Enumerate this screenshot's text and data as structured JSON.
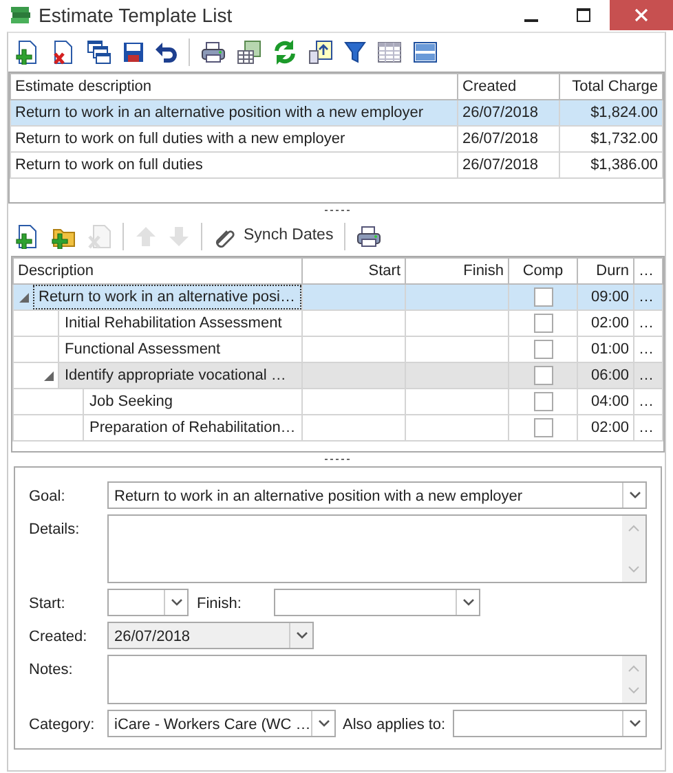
{
  "window": {
    "title": "Estimate Template List"
  },
  "templates": {
    "columns": [
      "Estimate description",
      "Created",
      "Total Charge"
    ],
    "rows": [
      {
        "description": "Return to work in an alternative position with a new employer",
        "created": "26/07/2018",
        "total_charge": "$1,824.00",
        "selected": true
      },
      {
        "description": "Return to work on full duties with a new employer",
        "created": "26/07/2018",
        "total_charge": "$1,732.00",
        "selected": false
      },
      {
        "description": "Return to work on full duties",
        "created": "26/07/2018",
        "total_charge": "$1,386.00",
        "selected": false
      }
    ]
  },
  "task_toolbar": {
    "groups": [
      [
        {
          "kind": "add",
          "disabled": false
        },
        {
          "kind": "add-folder",
          "disabled": false
        },
        {
          "kind": "delete",
          "disabled": true
        }
      ],
      [
        {
          "kind": "up",
          "disabled": true
        },
        {
          "kind": "down",
          "disabled": true
        }
      ],
      [
        {
          "kind": "synch",
          "label": "Synch Dates",
          "disabled": false
        }
      ],
      [
        {
          "kind": "print",
          "disabled": false
        }
      ]
    ]
  },
  "tasks": {
    "columns": [
      "Description",
      "Start",
      "Finish",
      "Comp",
      "Durn",
      "…"
    ],
    "rows": [
      {
        "description": "Return to work in an alternative posi…",
        "comp": false,
        "durn": "09:00",
        "more": "…",
        "selected": true,
        "expanded": true,
        "children": [
          {
            "description": "Initial Rehabilitation Assessment",
            "comp": false,
            "durn": "02:00",
            "more": "…",
            "selected": false
          },
          {
            "description": "Functional Assessment",
            "comp": false,
            "durn": "01:00",
            "more": "…",
            "selected": false
          },
          {
            "description": "Identify appropriate vocational …",
            "comp": false,
            "durn": "06:00",
            "more": "…",
            "selected": false,
            "expanded": true,
            "children": [
              {
                "description": "Job Seeking",
                "comp": false,
                "durn": "04:00",
                "more": "…",
                "selected": false
              },
              {
                "description": "Preparation of Rehabilitation…",
                "comp": false,
                "durn": "02:00",
                "more": "…",
                "selected": false
              }
            ]
          }
        ]
      }
    ]
  },
  "form": {
    "goal": {
      "label": "Goal:",
      "value": "Return to work in an alternative position with a new employer"
    },
    "details": {
      "label": "Details:"
    },
    "start": {
      "label": "Start:"
    },
    "finish": {
      "label": "Finish:"
    },
    "created": {
      "label": "Created:",
      "value": "26/07/2018",
      "disabled": true
    },
    "notes": {
      "label": "Notes:"
    },
    "category": {
      "label": "Category:",
      "value": "iCare - Workers Care (WC …"
    },
    "also_applies_to": {
      "label": "Also applies to:"
    }
  }
}
